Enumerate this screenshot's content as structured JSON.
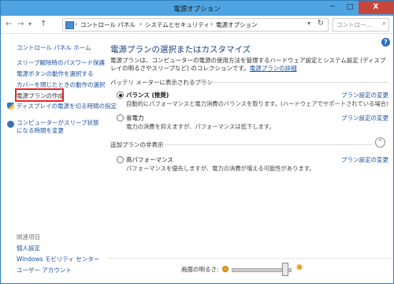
{
  "window": {
    "title": "電源オプション",
    "minimize": "─",
    "maximize": "□",
    "close": "X"
  },
  "nav": {
    "back": "←",
    "forward": "→",
    "history": "▾",
    "up": "↑"
  },
  "address": {
    "breadcrumb": [
      "コントロール パネル",
      "システムとセキュリティ",
      "電源オプション"
    ],
    "separator": "›",
    "dropdown": "▾",
    "refresh": "↻",
    "search_placeholder": "コントロー...",
    "search_icon": "⌕"
  },
  "help_label": "?",
  "sidebar": {
    "home": "コントロール パネル ホーム",
    "items": [
      "スリープ解除時のパスワード保護",
      "電源ボタンの動作を選択する",
      "カバーを閉じたときの動作の選択",
      "電源プランの作成",
      "ディスプレイの電源を切る時間の指定",
      "コンピューターがスリープ状態になる時間を変更"
    ],
    "see_also_title": "関連項目",
    "see_also": [
      "個人設定",
      "Windows モビリティ センター",
      "ユーザー アカウント"
    ]
  },
  "main": {
    "heading": "電源プランの選択またはカスタマイズ",
    "description": "電源プランは、コンピューターの電源の使用方法を管理するハードウェア設定とシステム設定 (ディスプレイの明るさやスリープなど) のコレクションです。",
    "description_link": "電源プランの詳細",
    "battery_section": "バッテリ メーターに表示されるプラン",
    "plans": [
      {
        "name": "バランス (推奨)",
        "desc": "自動的にパフォーマンスと電力消費のバランスを取ります。(ハードウェアでサポートされている場合)",
        "selected": true,
        "change": "プラン設定の変更"
      },
      {
        "name": "省電力",
        "desc": "電力の消費を抑えますが、パフォーマンスは低下します。",
        "selected": false,
        "change": "プラン設定の変更"
      }
    ],
    "additional_section": "追加プランの非表示",
    "collapse_icon": "^",
    "additional_plans": [
      {
        "name": "高パフォーマンス",
        "desc": "パフォーマンスを優先しますが、電力の消費が増える可能性があります。",
        "selected": false,
        "change": "プラン設定の変更"
      }
    ]
  },
  "brightness": {
    "label": "画面の明るさ:",
    "level": 0.9,
    "bright_icon": "✹"
  },
  "colors": {
    "titlebar": "#4ea4e2",
    "link": "#1b52a3",
    "highlight_box": "#e8252b"
  }
}
